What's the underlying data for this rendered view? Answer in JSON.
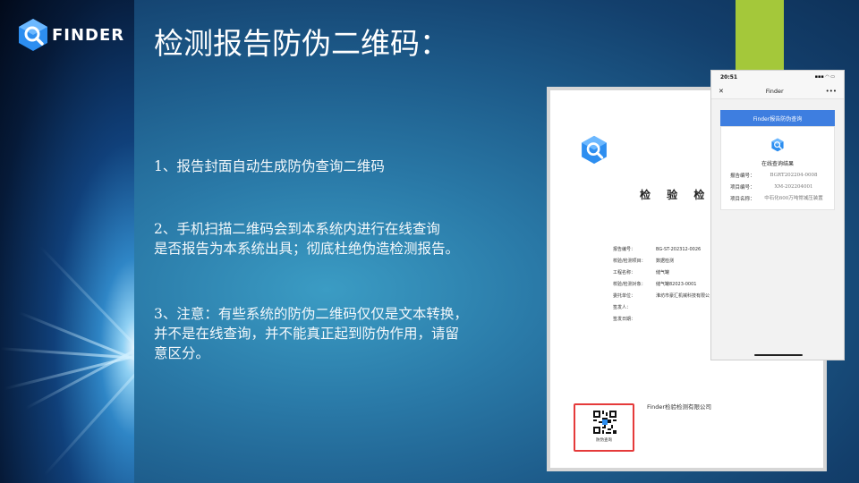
{
  "logo": {
    "name": "FINDER",
    "icon": "finder-logo-icon"
  },
  "title": "检测报告防伪二维码：",
  "points": [
    {
      "lines": [
        "1、报告封面自动生成防伪查询二维码"
      ]
    },
    {
      "lines": [
        "2、手机扫描二维码会到本系统内进行在线查询",
        "是否报告为本系统出具；彻底杜绝伪造检测报告。"
      ]
    },
    {
      "lines": [
        "3、注意：有些系统的防伪二维码仅仅是文本转换，",
        "并不是在线查询，并不能真正起到防伪作用，请留",
        "意区分。"
      ]
    }
  ],
  "document": {
    "title": "检 验 检 测 报",
    "fields": [
      {
        "k": "报告编号：",
        "v": "BG-ST-202312-0026"
      },
      {
        "k": "校验/检测项目：",
        "v": "数据检测"
      },
      {
        "k": "工程名称：",
        "v": "储气罐"
      },
      {
        "k": "校验/检测对象：",
        "v": "储气罐82023-0001"
      },
      {
        "k": "委托单位：",
        "v": "淮坊市豪汇机械科技有限公"
      },
      {
        "k": "签发人：",
        "v": ""
      },
      {
        "k": "签发日期：",
        "v": ""
      }
    ],
    "company": "Finder检验检测有限公司",
    "qr_caption": "防伪查询"
  },
  "phone": {
    "time": "20:51",
    "signal": "▪▪▪ ◠ ▭",
    "close": "✕",
    "nav_title": "Finder",
    "more": "•••",
    "query_button": "Finder报告防伪查询",
    "result_title": "在线查询结果",
    "rows": [
      {
        "k": "报告编号：",
        "v": "BGRT202204-0008"
      },
      {
        "k": "项目编号：",
        "v": "XM-202204001"
      },
      {
        "k": "项目名称：",
        "v": "中石化600万吨常减压装置"
      }
    ]
  },
  "colors": {
    "accent_green": "#a4c83a",
    "qr_border": "#e53a3a",
    "query_button": "#3e7ee0",
    "logo_blue": "#2d8ef0"
  }
}
